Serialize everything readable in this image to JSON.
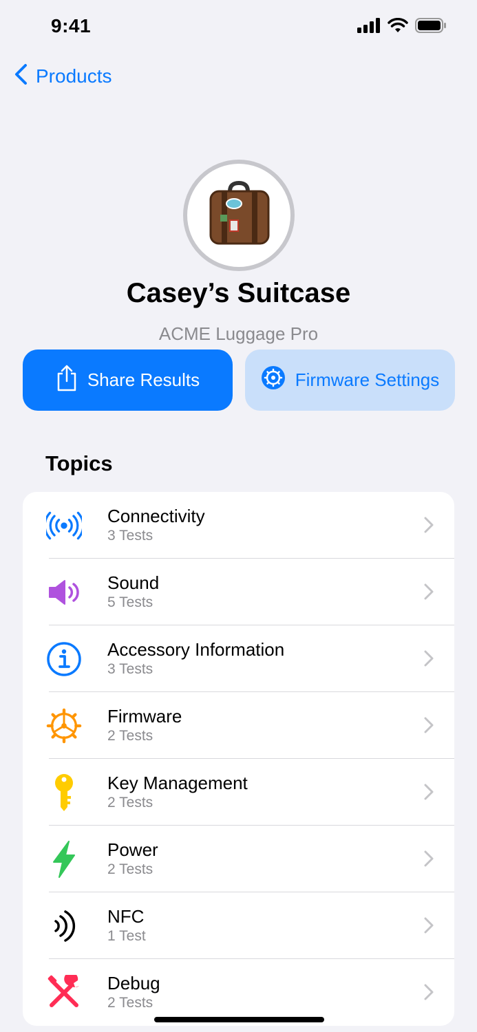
{
  "status_bar": {
    "time": "9:41"
  },
  "nav": {
    "back_label": "Products"
  },
  "header": {
    "title": "Casey’s Suitcase",
    "subtitle": "ACME Luggage Pro",
    "share_label": "Share Results",
    "firmware_label": "Firmware Settings"
  },
  "topics": {
    "title": "Topics",
    "items": [
      {
        "label": "Connectivity",
        "detail": "3 Tests",
        "icon": "antenna-icon",
        "color": "#0A7AFF"
      },
      {
        "label": "Sound",
        "detail": "5 Tests",
        "icon": "speaker-icon",
        "color": "#AF52DE"
      },
      {
        "label": "Accessory Information",
        "detail": "3 Tests",
        "icon": "info-icon",
        "color": "#0A7AFF"
      },
      {
        "label": "Firmware",
        "detail": "2 Tests",
        "icon": "gear-icon",
        "color": "#FF9500"
      },
      {
        "label": "Key Management",
        "detail": "2 Tests",
        "icon": "key-icon",
        "color": "#FFCC00"
      },
      {
        "label": "Power",
        "detail": "2 Tests",
        "icon": "bolt-icon",
        "color": "#34C759"
      },
      {
        "label": "NFC",
        "detail": "1 Test",
        "icon": "nfc-icon",
        "color": "#000000"
      },
      {
        "label": "Debug",
        "detail": "2 Tests",
        "icon": "tools-icon",
        "color": "#FF2D55"
      }
    ]
  }
}
